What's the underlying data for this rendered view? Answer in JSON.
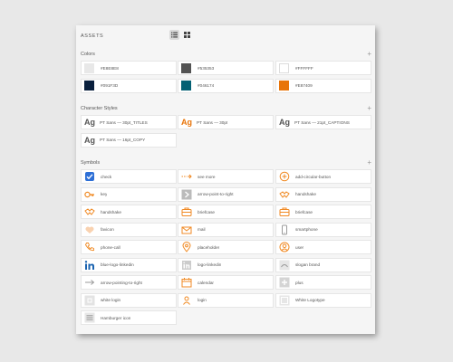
{
  "panel": {
    "title": "ASSETS"
  },
  "view_modes": [
    {
      "icon": "list-view-icon",
      "active": true
    },
    {
      "icon": "grid-view-icon",
      "active": false
    }
  ],
  "sections": {
    "colors": {
      "title": "Colors",
      "add_icon": "plus-icon",
      "add_label": "+"
    },
    "character_styles": {
      "title": "Character Styles",
      "add_icon": "plus-icon",
      "add_label": "+"
    },
    "symbols": {
      "title": "Symbols",
      "add_icon": "plus-icon",
      "add_label": "+"
    }
  },
  "colors": [
    {
      "label": "#E8E8E8",
      "hex": "#E8E8E8"
    },
    {
      "label": "#535353",
      "hex": "#535353"
    },
    {
      "label": "#FFFFFF",
      "hex": "#FFFFFF"
    },
    {
      "label": "#091F3D",
      "hex": "#091F3D"
    },
    {
      "label": "#046174",
      "hex": "#046174"
    },
    {
      "label": "#E87409",
      "hex": "#E87409"
    }
  ],
  "character_styles": [
    {
      "sample": "Ag",
      "label": "PT Sans — 30pt_TITLES",
      "color": "#555555"
    },
    {
      "sample": "Ag",
      "label": "PT Sans — 30pt",
      "color": "#E87409"
    },
    {
      "sample": "Ag",
      "label": "PT Sans — 21pt_CAPTIONS",
      "color": "#555555"
    },
    {
      "sample": "Ag",
      "label": "PT Sans — 16pt_COPY",
      "color": "#555555"
    }
  ],
  "symbols": [
    {
      "label": "check",
      "icon": "check-icon"
    },
    {
      "label": "see more",
      "icon": "see-more-icon"
    },
    {
      "label": "add-circular-button",
      "icon": "add-circle-icon"
    },
    {
      "label": "key",
      "icon": "key-icon"
    },
    {
      "label": "arrow-point-to-right",
      "icon": "arrow-right-icon"
    },
    {
      "label": "handshake",
      "icon": "handshake-icon"
    },
    {
      "label": "handshake",
      "icon": "handshake-icon"
    },
    {
      "label": "briefcase",
      "icon": "briefcase-icon"
    },
    {
      "label": "briefcase",
      "icon": "briefcase-icon"
    },
    {
      "label": "favicon",
      "icon": "favicon-icon"
    },
    {
      "label": "mail",
      "icon": "mail-icon"
    },
    {
      "label": "smartphone",
      "icon": "smartphone-icon"
    },
    {
      "label": "phone-call",
      "icon": "phone-icon"
    },
    {
      "label": "placeholder",
      "icon": "map-pin-icon"
    },
    {
      "label": "user",
      "icon": "user-icon"
    },
    {
      "label": "blue-logo-linkedin",
      "icon": "linkedin-icon"
    },
    {
      "label": "logo-linkedin",
      "icon": "linkedin-gray-icon"
    },
    {
      "label": "slogan brand",
      "icon": "slogan-icon"
    },
    {
      "label": "arrow-pointing-to-right",
      "icon": "arrow-long-right-icon"
    },
    {
      "label": "calendar",
      "icon": "calendar-icon"
    },
    {
      "label": "plus",
      "icon": "plus-gray-icon"
    },
    {
      "label": "white login",
      "icon": "white-login-icon"
    },
    {
      "label": "login",
      "icon": "login-icon"
    },
    {
      "label": "White Logotype",
      "icon": "logotype-icon"
    },
    {
      "label": "Hamburger icon",
      "icon": "hamburger-icon"
    }
  ]
}
